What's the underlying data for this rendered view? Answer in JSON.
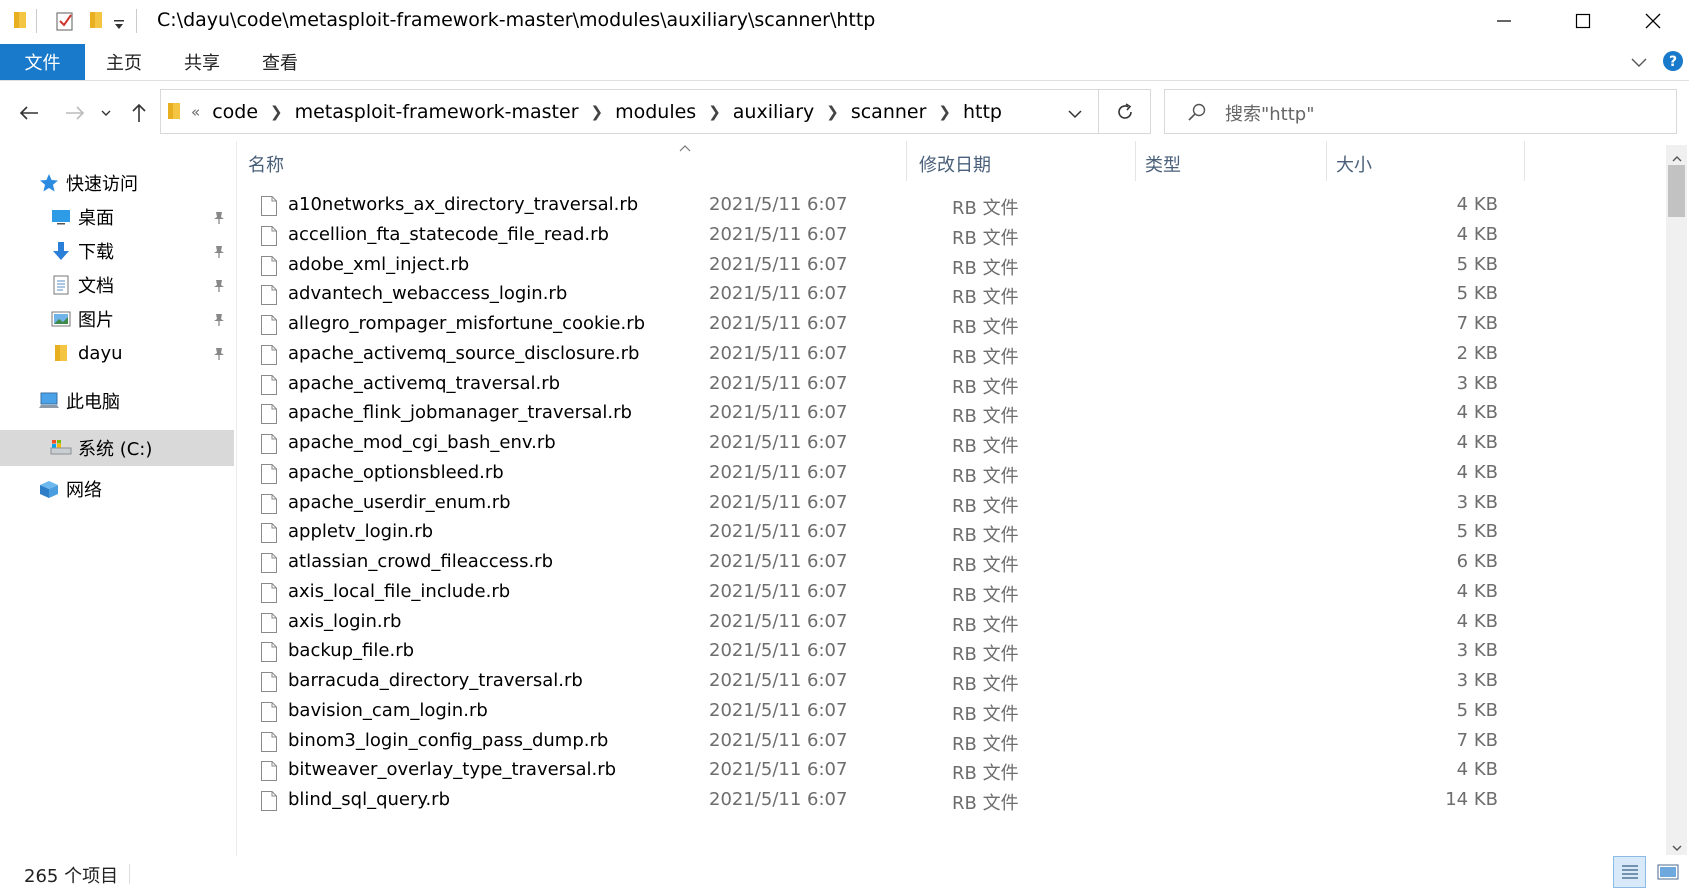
{
  "window": {
    "title": "C:\\dayu\\code\\metasploit-framework-master\\modules\\auxiliary\\scanner\\http"
  },
  "ribbon": {
    "tabs": [
      {
        "label": "文件"
      },
      {
        "label": "主页"
      },
      {
        "label": "共享"
      },
      {
        "label": "查看"
      }
    ],
    "accent": "#1979ca"
  },
  "address": {
    "overflow": "«",
    "crumbs": [
      "code",
      "metasploit-framework-master",
      "modules",
      "auxiliary",
      "scanner",
      "http"
    ]
  },
  "search": {
    "placeholder": "搜索\"http\""
  },
  "nav": {
    "quick_access": "快速访问",
    "pinned": [
      {
        "label": "桌面",
        "icon": "desktop-icon"
      },
      {
        "label": "下载",
        "icon": "download-icon"
      },
      {
        "label": "文档",
        "icon": "document-icon"
      },
      {
        "label": "图片",
        "icon": "pictures-icon"
      },
      {
        "label": "dayu",
        "icon": "folder-icon"
      }
    ],
    "this_pc": "此电脑",
    "drive": "系统 (C:)",
    "network": "网络"
  },
  "columns": {
    "name": "名称",
    "date": "修改日期",
    "type": "类型",
    "size": "大小"
  },
  "files": [
    {
      "name": "a10networks_ax_directory_traversal.rb",
      "date": "2021/5/11 6:07",
      "type": "RB 文件",
      "size": "4 KB"
    },
    {
      "name": "accellion_fta_statecode_file_read.rb",
      "date": "2021/5/11 6:07",
      "type": "RB 文件",
      "size": "4 KB"
    },
    {
      "name": "adobe_xml_inject.rb",
      "date": "2021/5/11 6:07",
      "type": "RB 文件",
      "size": "5 KB"
    },
    {
      "name": "advantech_webaccess_login.rb",
      "date": "2021/5/11 6:07",
      "type": "RB 文件",
      "size": "5 KB"
    },
    {
      "name": "allegro_rompager_misfortune_cookie.rb",
      "date": "2021/5/11 6:07",
      "type": "RB 文件",
      "size": "7 KB"
    },
    {
      "name": "apache_activemq_source_disclosure.rb",
      "date": "2021/5/11 6:07",
      "type": "RB 文件",
      "size": "2 KB"
    },
    {
      "name": "apache_activemq_traversal.rb",
      "date": "2021/5/11 6:07",
      "type": "RB 文件",
      "size": "3 KB"
    },
    {
      "name": "apache_flink_jobmanager_traversal.rb",
      "date": "2021/5/11 6:07",
      "type": "RB 文件",
      "size": "4 KB"
    },
    {
      "name": "apache_mod_cgi_bash_env.rb",
      "date": "2021/5/11 6:07",
      "type": "RB 文件",
      "size": "4 KB"
    },
    {
      "name": "apache_optionsbleed.rb",
      "date": "2021/5/11 6:07",
      "type": "RB 文件",
      "size": "4 KB"
    },
    {
      "name": "apache_userdir_enum.rb",
      "date": "2021/5/11 6:07",
      "type": "RB 文件",
      "size": "3 KB"
    },
    {
      "name": "appletv_login.rb",
      "date": "2021/5/11 6:07",
      "type": "RB 文件",
      "size": "5 KB"
    },
    {
      "name": "atlassian_crowd_fileaccess.rb",
      "date": "2021/5/11 6:07",
      "type": "RB 文件",
      "size": "6 KB"
    },
    {
      "name": "axis_local_file_include.rb",
      "date": "2021/5/11 6:07",
      "type": "RB 文件",
      "size": "4 KB"
    },
    {
      "name": "axis_login.rb",
      "date": "2021/5/11 6:07",
      "type": "RB 文件",
      "size": "4 KB"
    },
    {
      "name": "backup_file.rb",
      "date": "2021/5/11 6:07",
      "type": "RB 文件",
      "size": "3 KB"
    },
    {
      "name": "barracuda_directory_traversal.rb",
      "date": "2021/5/11 6:07",
      "type": "RB 文件",
      "size": "3 KB"
    },
    {
      "name": "bavision_cam_login.rb",
      "date": "2021/5/11 6:07",
      "type": "RB 文件",
      "size": "5 KB"
    },
    {
      "name": "binom3_login_config_pass_dump.rb",
      "date": "2021/5/11 6:07",
      "type": "RB 文件",
      "size": "7 KB"
    },
    {
      "name": "bitweaver_overlay_type_traversal.rb",
      "date": "2021/5/11 6:07",
      "type": "RB 文件",
      "size": "4 KB"
    },
    {
      "name": "blind_sql_query.rb",
      "date": "2021/5/11 6:07",
      "type": "RB 文件",
      "size": "14 KB"
    }
  ],
  "status": {
    "count": "265 个项目"
  }
}
